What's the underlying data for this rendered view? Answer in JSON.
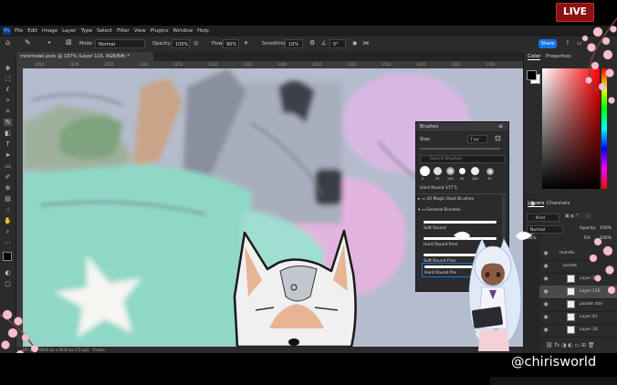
{
  "live_badge": "LIVE",
  "menu": {
    "logo": "Ps",
    "items": [
      "File",
      "Edit",
      "Image",
      "Layer",
      "Type",
      "Select",
      "Filter",
      "View",
      "Plugins",
      "Window",
      "Help"
    ]
  },
  "options": {
    "mode_label": "Mode:",
    "mode_value": "Normal",
    "opacity_label": "Opacity:",
    "opacity_value": "100%",
    "flow_label": "Flow:",
    "flow_value": "90%",
    "smoothing_label": "Smoothing:",
    "smoothing_value": "10%",
    "angle_value": "0°",
    "share_label": "Share"
  },
  "document": {
    "tab_title": "minimodel.psdc @ 197% (Layer 116, RGB/8#) *",
    "ruler_ticks": [
      "1050",
      "1100",
      "1150",
      "1200",
      "1250",
      "1300",
      "1350",
      "1400",
      "1450",
      "1500",
      "1550",
      "1600",
      "1650",
      "1700"
    ],
    "status_zoom": "197.2%",
    "status_info": "8020 px x 8020 px (72 ppi)",
    "status_extra": "Frozen"
  },
  "brushes_panel": {
    "title": "Brushes",
    "size_label": "Size:",
    "size_value": "7 px",
    "search_placeholder": "Search Brushes",
    "recent_presets": [
      "5",
      "25",
      "200",
      "50",
      "100",
      "35"
    ],
    "selected_brush": "Hard Round 177 5",
    "groups": [
      "20 Magic Dust Brushes",
      "General Brushes"
    ],
    "brushes": [
      "Soft Round",
      "Hard Round Pres",
      "Soft Round Pres",
      "Hard Round Pre"
    ]
  },
  "color_panel": {
    "tabs": [
      "Color",
      "Properties"
    ],
    "foreground": "#000000",
    "background": "#ffffff"
  },
  "layers_panel": {
    "tabs": [
      "Layers",
      "Channels"
    ],
    "kind_label": "Kind",
    "blend_mode": "Normal",
    "opacity_label": "Opacity:",
    "opacity_value": "100%",
    "fill_label": "Fill:",
    "fill_value": "100%",
    "lock_label": "Lock:",
    "layers": [
      {
        "name": "mandis"
      },
      {
        "name": "pocket"
      },
      {
        "name": "Layer 117"
      },
      {
        "name": "Layer 116"
      },
      {
        "name": "pocket star"
      },
      {
        "name": "Layer 61"
      },
      {
        "name": "Layer 30"
      }
    ]
  },
  "overlay": {
    "handle": "@chirisworld"
  },
  "colors": {
    "accent": "#1473e6",
    "live_red": "#8a1212",
    "canvas_bg": "#aeb6c9",
    "mint": "#8fd8c6",
    "pink": "#e3b4e0",
    "blossom": "#f2b8c8"
  }
}
